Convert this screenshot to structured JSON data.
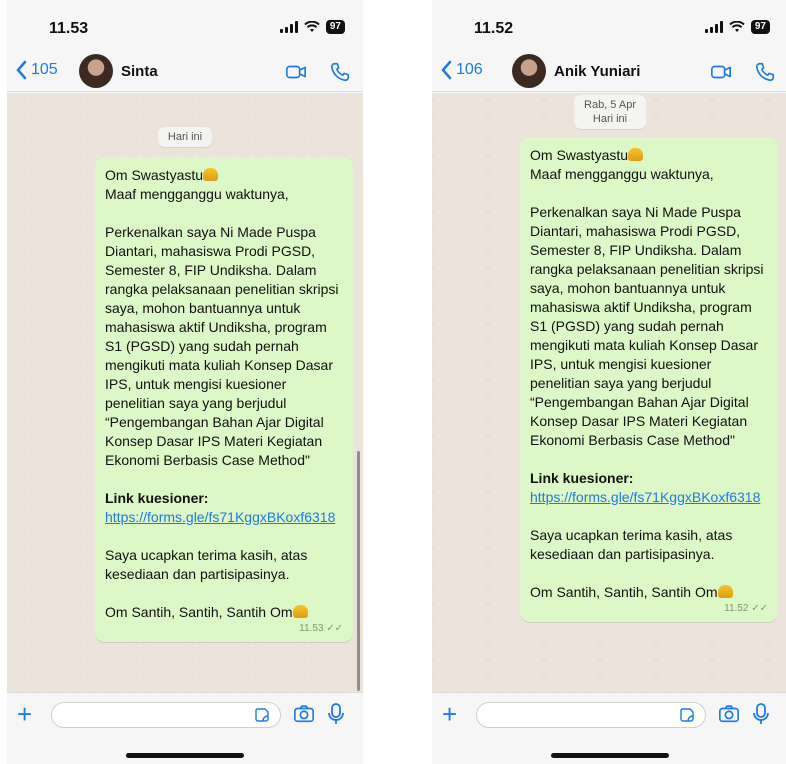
{
  "colors": {
    "accent": "#1f7ae0",
    "bubble": "#dcf8c6",
    "chat_bg": "#ece4da"
  },
  "left": {
    "status_time": "11.53",
    "battery": "97",
    "back_count": "105",
    "contact_name": "Sinta",
    "date_lines": [
      "Hari ini"
    ],
    "message": {
      "greeting": "Om Swastyastu",
      "line2": "Maaf mengganggu waktunya,",
      "body": "Perkenalkan saya Ni Made Puspa Diantari, mahasiswa Prodi PGSD, Semester 8, FIP Undiksha. Dalam rangka pelaksanaan penelitian skripsi saya, mohon bantuannya untuk mahasiswa aktif Undiksha, program S1 (PGSD) yang sudah pernah mengikuti mata kuliah Konsep Dasar IPS, untuk mengisi kuesioner penelitian saya yang berjudul “Pengembangan Bahan Ajar Digital Konsep Dasar IPS Materi Kegiatan Ekonomi Berbasis Case Method\"",
      "link_title": "Link kuesioner:",
      "link": "https://forms.gle/fs71KggxBKoxf6318",
      "thanks": "Saya ucapkan terima kasih, atas kesediaan dan partisipasinya.",
      "closing": "Om Santih, Santih, Santih Om",
      "time": "11.53"
    }
  },
  "right": {
    "status_time": "11.52",
    "battery": "97",
    "back_count": "106",
    "contact_name": "Anik Yuniari",
    "date_lines": [
      "Rab, 5 Apr",
      "Hari ini"
    ],
    "message": {
      "greeting": "Om Swastyastu",
      "line2": "Maaf mengganggu waktunya,",
      "body": "Perkenalkan saya Ni Made Puspa Diantari, mahasiswa Prodi PGSD, Semester 8, FIP Undiksha. Dalam rangka pelaksanaan penelitian skripsi saya, mohon bantuannya untuk mahasiswa aktif Undiksha, program S1 (PGSD) yang sudah pernah mengikuti mata kuliah Konsep Dasar IPS, untuk mengisi kuesioner penelitian saya yang berjudul “Pengembangan Bahan Ajar Digital Konsep Dasar IPS Materi Kegiatan Ekonomi Berbasis Case Method\"",
      "link_title": "Link kuesioner:",
      "link": "https://forms.gle/fs71KggxBKoxf6318",
      "thanks": "Saya ucapkan terima kasih, atas kesediaan dan partisipasinya.",
      "closing": "Om Santih, Santih, Santih Om",
      "time": "11.52"
    }
  }
}
